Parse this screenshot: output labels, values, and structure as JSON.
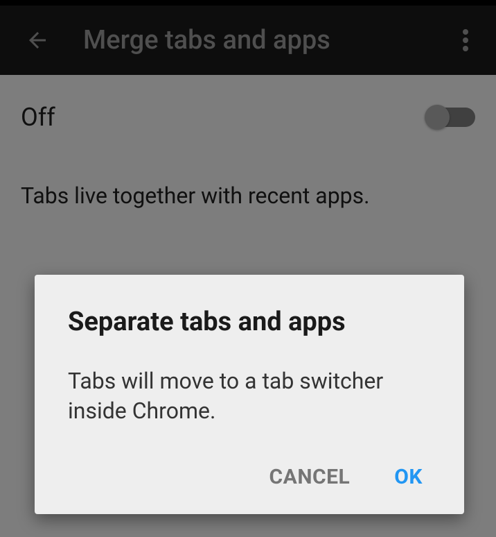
{
  "header": {
    "title": "Merge tabs and apps"
  },
  "setting": {
    "state_label": "Off",
    "description": "Tabs live together with recent apps."
  },
  "dialog": {
    "title": "Separate tabs and apps",
    "message": "Tabs will move to a tab switcher inside Chrome.",
    "cancel_label": "CANCEL",
    "ok_label": "OK"
  }
}
